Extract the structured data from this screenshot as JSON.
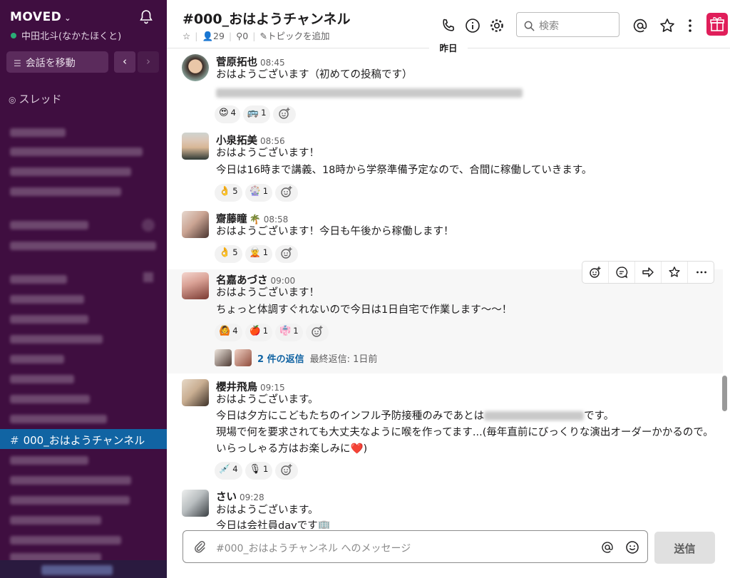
{
  "workspace": {
    "name": "MOVED",
    "user": "中田北斗(なかたほくと)"
  },
  "sidebar": {
    "jump_label": "会話を移動",
    "threads_label": "スレッド",
    "active_channel": "000_おはようチャンネル"
  },
  "channel": {
    "title": "#000_おはようチャンネル",
    "members": "29",
    "pins": "0",
    "add_topic": "トピックを追加"
  },
  "search": {
    "placeholder": "検索"
  },
  "day_divider": "昨日",
  "messages": [
    {
      "author": "菅原拓也",
      "time": "08:45",
      "lines": [
        "おはようございます（初めての投稿です）"
      ],
      "reactions": [
        {
          "emoji": "😍",
          "count": "4"
        },
        {
          "emoji": "🚌",
          "count": "1"
        }
      ]
    },
    {
      "author": "小泉拓美",
      "time": "08:56",
      "lines": [
        "おはようございます！",
        "今日は16時まで講義、18時から学祭準備予定なので、合間に稼働していきます。"
      ],
      "reactions": [
        {
          "emoji": "👌",
          "count": "5"
        },
        {
          "emoji": "🎡",
          "count": "1"
        }
      ]
    },
    {
      "author": "齋藤瞳",
      "status_emoji": "🌴",
      "time": "08:58",
      "lines": [
        "おはようございます！今日も午後から稼働します！"
      ],
      "reactions": [
        {
          "emoji": "👌",
          "count": "5"
        },
        {
          "emoji": "🧝",
          "count": "1"
        }
      ]
    },
    {
      "author": "名嘉あづさ",
      "time": "09:00",
      "lines": [
        "おはようございます！",
        "ちょっと体調すぐれないので今日は1日自宅で作業します〜〜！"
      ],
      "reactions": [
        {
          "emoji": "🙆",
          "count": "4"
        },
        {
          "emoji": "🍎",
          "count": "1"
        },
        {
          "emoji": "👘",
          "count": "1"
        }
      ],
      "thread": {
        "replies": "2 件の返信",
        "last": "最終返信: 1日前"
      }
    },
    {
      "author": "櫻井飛鳥",
      "time": "09:15",
      "lines": [
        "おはようございます。",
        "今日は夕方にこどもたちのインフル予防接種のみであとは",
        "です。",
        "現場で何を要求されても大丈夫なように喉を作ってます...(毎年直前にびっくりな演出オーダーかかるので。いらっしゃる方はお楽しみに❤️)"
      ],
      "reactions": [
        {
          "emoji": "💉",
          "count": "4"
        },
        {
          "emoji": "🎙",
          "count": "1"
        }
      ]
    },
    {
      "author": "さい",
      "time": "09:28",
      "lines": [
        "おはようございます。",
        "今日は会社員dayです🏢"
      ]
    }
  ],
  "composer": {
    "placeholder": "#000_おはようチャンネル へのメッセージ",
    "send_label": "送信"
  }
}
